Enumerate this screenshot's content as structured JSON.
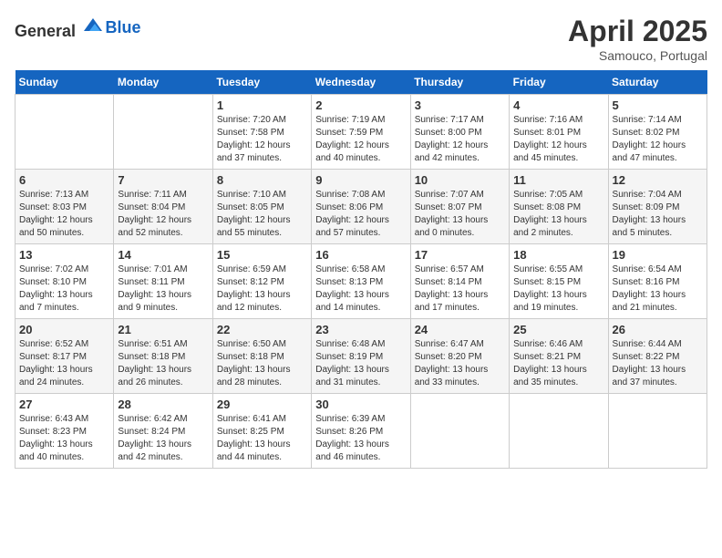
{
  "header": {
    "logo_general": "General",
    "logo_blue": "Blue",
    "title": "April 2025",
    "subtitle": "Samouco, Portugal"
  },
  "days_of_week": [
    "Sunday",
    "Monday",
    "Tuesday",
    "Wednesday",
    "Thursday",
    "Friday",
    "Saturday"
  ],
  "weeks": [
    [
      {
        "day": "",
        "sunrise": "",
        "sunset": "",
        "daylight": ""
      },
      {
        "day": "",
        "sunrise": "",
        "sunset": "",
        "daylight": ""
      },
      {
        "day": "1",
        "sunrise": "Sunrise: 7:20 AM",
        "sunset": "Sunset: 7:58 PM",
        "daylight": "Daylight: 12 hours and 37 minutes."
      },
      {
        "day": "2",
        "sunrise": "Sunrise: 7:19 AM",
        "sunset": "Sunset: 7:59 PM",
        "daylight": "Daylight: 12 hours and 40 minutes."
      },
      {
        "day": "3",
        "sunrise": "Sunrise: 7:17 AM",
        "sunset": "Sunset: 8:00 PM",
        "daylight": "Daylight: 12 hours and 42 minutes."
      },
      {
        "day": "4",
        "sunrise": "Sunrise: 7:16 AM",
        "sunset": "Sunset: 8:01 PM",
        "daylight": "Daylight: 12 hours and 45 minutes."
      },
      {
        "day": "5",
        "sunrise": "Sunrise: 7:14 AM",
        "sunset": "Sunset: 8:02 PM",
        "daylight": "Daylight: 12 hours and 47 minutes."
      }
    ],
    [
      {
        "day": "6",
        "sunrise": "Sunrise: 7:13 AM",
        "sunset": "Sunset: 8:03 PM",
        "daylight": "Daylight: 12 hours and 50 minutes."
      },
      {
        "day": "7",
        "sunrise": "Sunrise: 7:11 AM",
        "sunset": "Sunset: 8:04 PM",
        "daylight": "Daylight: 12 hours and 52 minutes."
      },
      {
        "day": "8",
        "sunrise": "Sunrise: 7:10 AM",
        "sunset": "Sunset: 8:05 PM",
        "daylight": "Daylight: 12 hours and 55 minutes."
      },
      {
        "day": "9",
        "sunrise": "Sunrise: 7:08 AM",
        "sunset": "Sunset: 8:06 PM",
        "daylight": "Daylight: 12 hours and 57 minutes."
      },
      {
        "day": "10",
        "sunrise": "Sunrise: 7:07 AM",
        "sunset": "Sunset: 8:07 PM",
        "daylight": "Daylight: 13 hours and 0 minutes."
      },
      {
        "day": "11",
        "sunrise": "Sunrise: 7:05 AM",
        "sunset": "Sunset: 8:08 PM",
        "daylight": "Daylight: 13 hours and 2 minutes."
      },
      {
        "day": "12",
        "sunrise": "Sunrise: 7:04 AM",
        "sunset": "Sunset: 8:09 PM",
        "daylight": "Daylight: 13 hours and 5 minutes."
      }
    ],
    [
      {
        "day": "13",
        "sunrise": "Sunrise: 7:02 AM",
        "sunset": "Sunset: 8:10 PM",
        "daylight": "Daylight: 13 hours and 7 minutes."
      },
      {
        "day": "14",
        "sunrise": "Sunrise: 7:01 AM",
        "sunset": "Sunset: 8:11 PM",
        "daylight": "Daylight: 13 hours and 9 minutes."
      },
      {
        "day": "15",
        "sunrise": "Sunrise: 6:59 AM",
        "sunset": "Sunset: 8:12 PM",
        "daylight": "Daylight: 13 hours and 12 minutes."
      },
      {
        "day": "16",
        "sunrise": "Sunrise: 6:58 AM",
        "sunset": "Sunset: 8:13 PM",
        "daylight": "Daylight: 13 hours and 14 minutes."
      },
      {
        "day": "17",
        "sunrise": "Sunrise: 6:57 AM",
        "sunset": "Sunset: 8:14 PM",
        "daylight": "Daylight: 13 hours and 17 minutes."
      },
      {
        "day": "18",
        "sunrise": "Sunrise: 6:55 AM",
        "sunset": "Sunset: 8:15 PM",
        "daylight": "Daylight: 13 hours and 19 minutes."
      },
      {
        "day": "19",
        "sunrise": "Sunrise: 6:54 AM",
        "sunset": "Sunset: 8:16 PM",
        "daylight": "Daylight: 13 hours and 21 minutes."
      }
    ],
    [
      {
        "day": "20",
        "sunrise": "Sunrise: 6:52 AM",
        "sunset": "Sunset: 8:17 PM",
        "daylight": "Daylight: 13 hours and 24 minutes."
      },
      {
        "day": "21",
        "sunrise": "Sunrise: 6:51 AM",
        "sunset": "Sunset: 8:18 PM",
        "daylight": "Daylight: 13 hours and 26 minutes."
      },
      {
        "day": "22",
        "sunrise": "Sunrise: 6:50 AM",
        "sunset": "Sunset: 8:18 PM",
        "daylight": "Daylight: 13 hours and 28 minutes."
      },
      {
        "day": "23",
        "sunrise": "Sunrise: 6:48 AM",
        "sunset": "Sunset: 8:19 PM",
        "daylight": "Daylight: 13 hours and 31 minutes."
      },
      {
        "day": "24",
        "sunrise": "Sunrise: 6:47 AM",
        "sunset": "Sunset: 8:20 PM",
        "daylight": "Daylight: 13 hours and 33 minutes."
      },
      {
        "day": "25",
        "sunrise": "Sunrise: 6:46 AM",
        "sunset": "Sunset: 8:21 PM",
        "daylight": "Daylight: 13 hours and 35 minutes."
      },
      {
        "day": "26",
        "sunrise": "Sunrise: 6:44 AM",
        "sunset": "Sunset: 8:22 PM",
        "daylight": "Daylight: 13 hours and 37 minutes."
      }
    ],
    [
      {
        "day": "27",
        "sunrise": "Sunrise: 6:43 AM",
        "sunset": "Sunset: 8:23 PM",
        "daylight": "Daylight: 13 hours and 40 minutes."
      },
      {
        "day": "28",
        "sunrise": "Sunrise: 6:42 AM",
        "sunset": "Sunset: 8:24 PM",
        "daylight": "Daylight: 13 hours and 42 minutes."
      },
      {
        "day": "29",
        "sunrise": "Sunrise: 6:41 AM",
        "sunset": "Sunset: 8:25 PM",
        "daylight": "Daylight: 13 hours and 44 minutes."
      },
      {
        "day": "30",
        "sunrise": "Sunrise: 6:39 AM",
        "sunset": "Sunset: 8:26 PM",
        "daylight": "Daylight: 13 hours and 46 minutes."
      },
      {
        "day": "",
        "sunrise": "",
        "sunset": "",
        "daylight": ""
      },
      {
        "day": "",
        "sunrise": "",
        "sunset": "",
        "daylight": ""
      },
      {
        "day": "",
        "sunrise": "",
        "sunset": "",
        "daylight": ""
      }
    ]
  ]
}
